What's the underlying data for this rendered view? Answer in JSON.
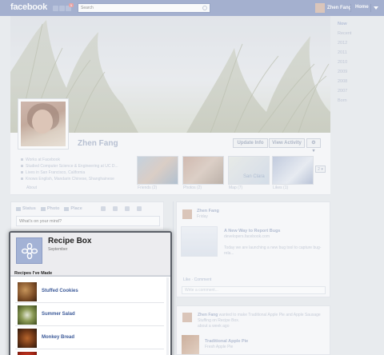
{
  "topbar": {
    "logo": "facebook",
    "notification_count": "1",
    "search_placeholder": "Search",
    "user_name": "Zhen Fang",
    "home_label": "Home"
  },
  "timeline_nav": [
    "Now",
    "Recent",
    "2012",
    "2011",
    "2010",
    "2009",
    "2008",
    "2007",
    "Born"
  ],
  "profile": {
    "name": "Zhen Fang",
    "update_info": "Update Info",
    "view_activity": "View Activity",
    "gear_label": "⚙ ▾",
    "info": [
      "Works at Facebook",
      "Studied Computer Science & Engineering at UC D...",
      "Lives in San Francisco, California",
      "Knows English, Mandarin Chinese, Shanghainese"
    ],
    "about_label": "About",
    "thumbs": [
      {
        "label": "Friends (2)"
      },
      {
        "label": "Photos (2)"
      },
      {
        "label": "Map (7)"
      },
      {
        "label": "Likes (1)"
      }
    ],
    "more_label": "2 ▾",
    "map_text": "San Clara"
  },
  "composer": {
    "tabs": [
      "Status",
      "Photo",
      "Place"
    ],
    "placeholder": "What's on your mind?"
  },
  "story1": {
    "name": "Zhen Fang",
    "time": "Friday",
    "link_title": "A New Way to Report Bugs",
    "link_url": "developers.facebook.com",
    "link_desc": "Today we are launching a new bug tool to capture bug-rela...",
    "actions": "Like · Comment",
    "comment_placeholder": "Write a comment..."
  },
  "story2": {
    "actor": "Zhen Fang",
    "text_mid": " wanted to make Traditional Apple Pie and Apple Sausage Stuffing on Recipe Box.",
    "time": "about a week ago",
    "title": "Traditional Apple Pie",
    "subtitle": "Fresh Apple Pie"
  },
  "popup": {
    "title": "Recipe Box",
    "subtitle": "September",
    "section": "Recipes I've Made",
    "recipes": [
      {
        "name": "Stuffed Cookies"
      },
      {
        "name": "Summer Salad"
      },
      {
        "name": "Monkey Bread"
      },
      {
        "name": ""
      }
    ]
  }
}
